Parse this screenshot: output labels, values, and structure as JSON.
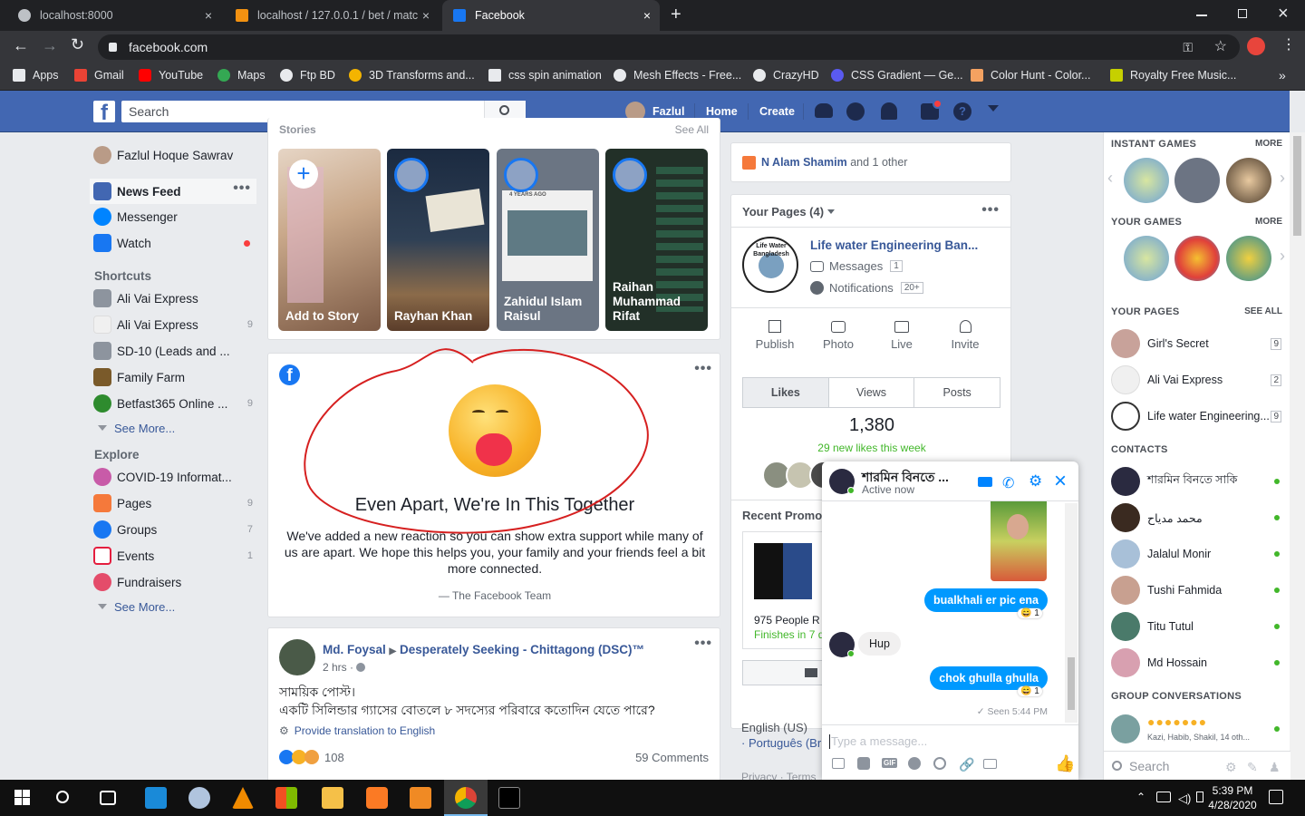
{
  "browser": {
    "tabs": [
      {
        "title": "localhost:8000"
      },
      {
        "title": "localhost / 127.0.0.1 / bet / matc"
      },
      {
        "title": "Facebook"
      }
    ],
    "url": "facebook.com",
    "bookmarks": [
      "Apps",
      "Gmail",
      "YouTube",
      "Maps",
      "Ftp BD",
      "3D Transforms and...",
      "css spin animation",
      "Mesh Effects - Free...",
      "CrazyHD",
      "CSS Gradient — Ge...",
      "Color Hunt - Color...",
      "Royalty Free Music..."
    ],
    "new_tab": "+",
    "close": "×",
    "more_bookmarks": "»"
  },
  "header": {
    "search_placeholder": "Search",
    "user": "Fazlul",
    "home": "Home",
    "create": "Create"
  },
  "left": {
    "profile": "Fazlul Hoque Sawrav",
    "main": [
      {
        "label": "News Feed",
        "count": ""
      },
      {
        "label": "Messenger",
        "count": ""
      },
      {
        "label": "Watch",
        "count": ""
      }
    ],
    "shortcuts_title": "Shortcuts",
    "shortcuts": [
      {
        "label": "Ali Vai Express",
        "count": ""
      },
      {
        "label": "Ali Vai Express",
        "count": "9"
      },
      {
        "label": "SD-10 (Leads and ...",
        "count": ""
      },
      {
        "label": "Family Farm",
        "count": ""
      },
      {
        "label": "Betfast365 Online ...",
        "count": "9"
      }
    ],
    "see_more": "See More...",
    "explore_title": "Explore",
    "explore": [
      {
        "label": "COVID-19 Informat...",
        "count": ""
      },
      {
        "label": "Pages",
        "count": "9"
      },
      {
        "label": "Groups",
        "count": "7"
      },
      {
        "label": "Events",
        "count": "1"
      },
      {
        "label": "Fundraisers",
        "count": ""
      }
    ]
  },
  "stories": {
    "partial_title": "Stories",
    "partial_see_all": "See All",
    "items": [
      "Add to Story",
      "Rayhan Khan",
      "Zahidul Islam Raisul",
      "Raihan Muhammad Rifat"
    ],
    "add_symbol": "+",
    "badge": "4 YEARS AGO"
  },
  "care_post": {
    "title": "Even Apart, We're In This Together",
    "body": "We've added a new reaction so you can show extra support while many of us are apart. We hope this helps you, your family and your friends feel a bit more connected.",
    "signature": "— The Facebook Team",
    "logo": "f"
  },
  "post": {
    "author": "Md. Foysal",
    "arrow": "▶",
    "group": "Desperately Seeking - Chittagong (DSC)™",
    "time": "2 hrs ·",
    "line1": "সাময়িক পোস্ট।",
    "line2": "একটি সিলিন্ডার গ্যাসের বোতলে ৮ সদস্যের পরিবারে কতোদিন যেতে পারে?",
    "translate": "Provide translation to English",
    "reactions": "108",
    "comments": "59 Comments"
  },
  "right": {
    "notif_name": "N Alam Shamim",
    "notif_rest": "and 1 other",
    "pages_title": "Your Pages (4)",
    "page_name": "Life water Engineering Ban...",
    "messages": "Messages",
    "messages_count": "1",
    "notifications": "Notifications",
    "notifications_count": "20+",
    "actions": [
      "Publish",
      "Photo",
      "Live",
      "Invite"
    ],
    "tabs": [
      "Likes",
      "Views",
      "Posts"
    ],
    "likes": "1,380",
    "new_likes": "29 new likes this week",
    "recent_promo": "Recent Promo",
    "people": "975 People R",
    "finishes": "Finishes in 7 d",
    "lang1": "English (US)",
    "lang_sep": "·",
    "lang2": "Português (Br",
    "footer": "Privacy · Terms",
    "logo_text": "Life Water Bangladesh"
  },
  "sidebar": {
    "instant_games": "INSTANT GAMES",
    "your_games": "YOUR GAMES",
    "more": "MORE",
    "your_pages": "YOUR PAGES",
    "see_all": "SEE ALL",
    "pages": [
      {
        "label": "Girl's Secret",
        "count": "9"
      },
      {
        "label": "Ali Vai Express",
        "count": "2"
      },
      {
        "label": "Life water Engineering...",
        "count": "9"
      }
    ],
    "contacts_title": "CONTACTS",
    "contacts": [
      "শারমিন বিনতে সাকি",
      "محمد مدياح",
      "Jalalul Monir",
      "Tushi Fahmida",
      "Titu Tutul",
      "Md Hossain"
    ],
    "group_title": "GROUP CONVERSATIONS",
    "group_members": "Kazi, Habib, Shakil, 14 oth...",
    "search_placeholder": "Search",
    "prev": "‹",
    "next": "›"
  },
  "messenger": {
    "name": "শারমিন বিনতে ...",
    "status": "Active now",
    "msg1": "bualkhali er pic ena",
    "msg2": "Hup",
    "msg3": "chok ghulla ghulla",
    "react_count": "1",
    "seen": "Seen 5:44 PM",
    "placeholder": "Type a message...",
    "close": "×",
    "gif": "GIF"
  },
  "taskbar": {
    "time": "5:39 PM",
    "date": "4/28/2020"
  },
  "colors": {
    "fb_blue": "#4267b2",
    "messenger_blue": "#0099ff",
    "online": "#42b72a"
  }
}
